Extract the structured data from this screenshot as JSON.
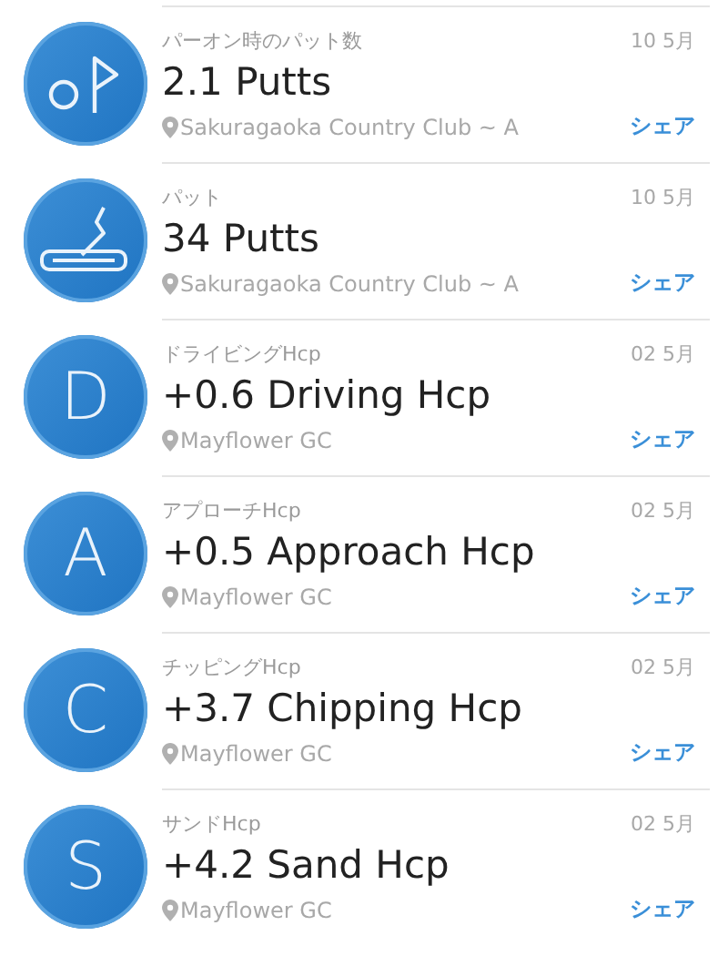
{
  "entries": [
    {
      "avatar": {
        "kind": "flag"
      },
      "category": "パーオン時のパット数",
      "date": "10 5月",
      "title": "2.1 Putts",
      "location": "Sakuragaoka Country Club ~ A",
      "action": "シェア"
    },
    {
      "avatar": {
        "kind": "putter"
      },
      "category": "パット",
      "date": "10 5月",
      "title": "34 Putts",
      "location": "Sakuragaoka Country Club ~ A",
      "action": "シェア"
    },
    {
      "avatar": {
        "kind": "letter",
        "letter": "D"
      },
      "category": "ドライビングHcp",
      "date": "02 5月",
      "title": "+0.6 Driving Hcp",
      "location": "Mayflower GC",
      "action": "シェア"
    },
    {
      "avatar": {
        "kind": "letter",
        "letter": "A"
      },
      "category": "アプローチHcp",
      "date": "02 5月",
      "title": "+0.5 Approach Hcp",
      "location": "Mayflower GC",
      "action": "シェア"
    },
    {
      "avatar": {
        "kind": "letter",
        "letter": "C"
      },
      "category": "チッピングHcp",
      "date": "02 5月",
      "title": "+3.7 Chipping Hcp",
      "location": "Mayflower GC",
      "action": "シェア"
    },
    {
      "avatar": {
        "kind": "letter",
        "letter": "S"
      },
      "category": "サンドHcp",
      "date": "02 5月",
      "title": "+4.2 Sand Hcp",
      "location": "Mayflower GC",
      "action": "シェア"
    }
  ]
}
